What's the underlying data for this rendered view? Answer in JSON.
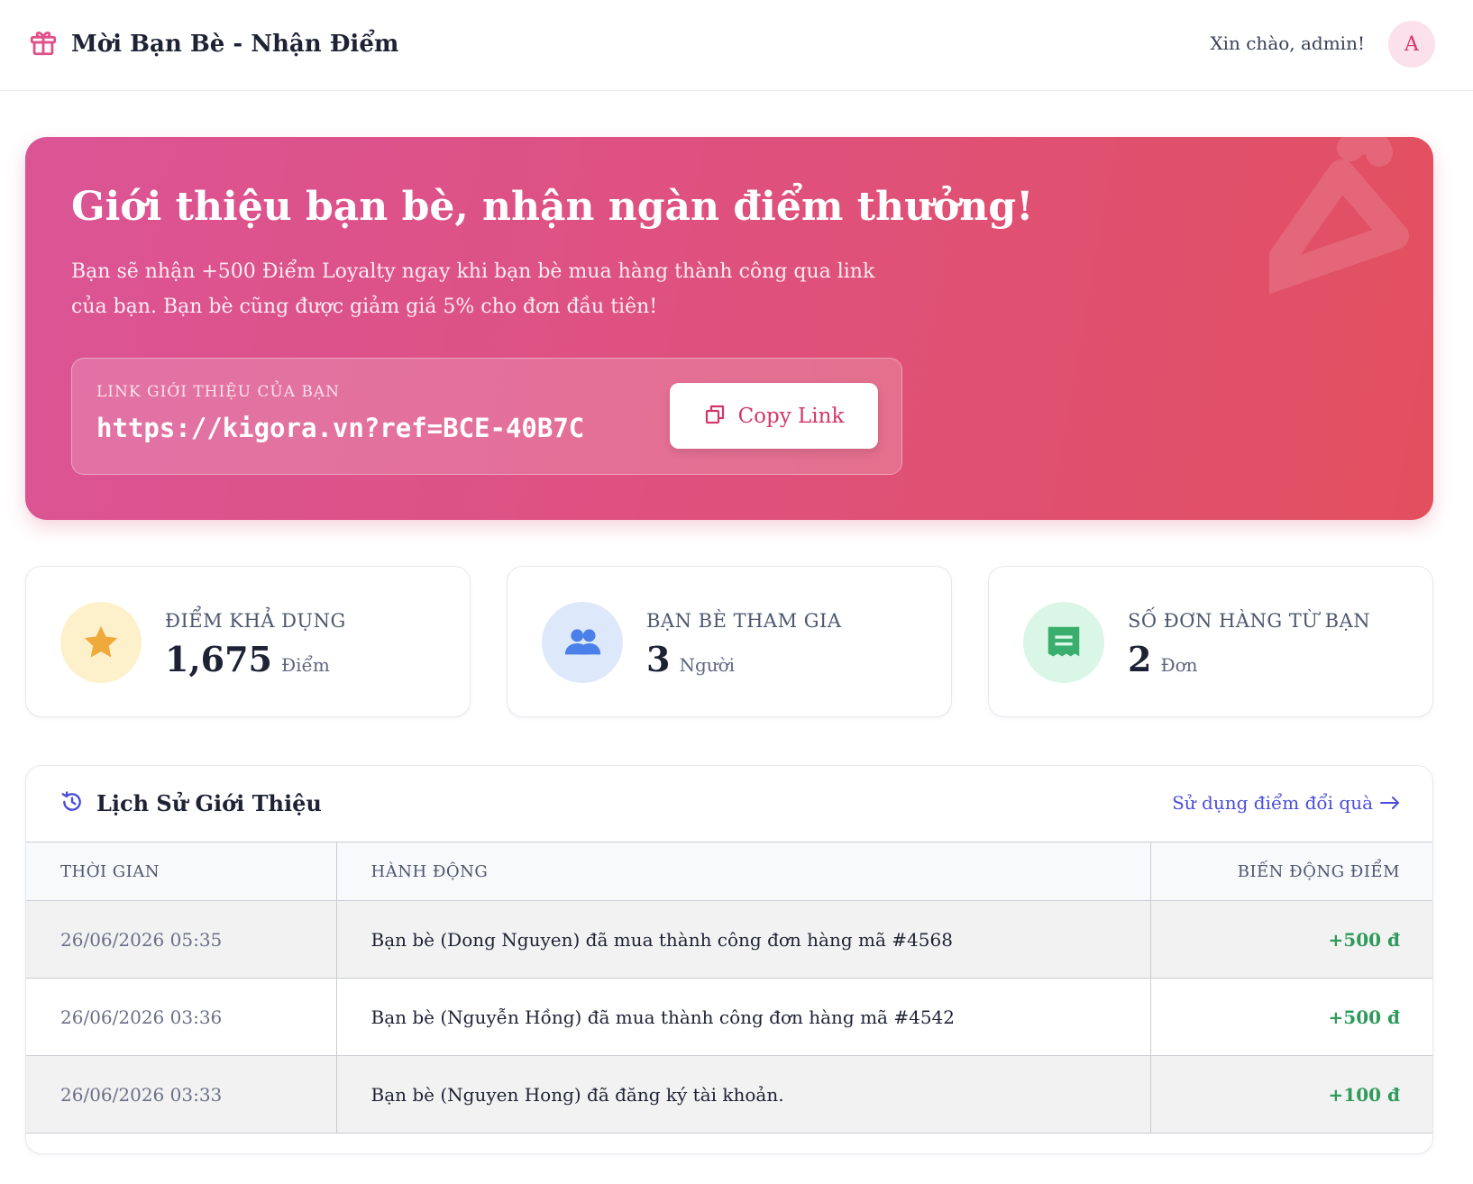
{
  "header": {
    "title": "Mời Bạn Bè - Nhận Điểm",
    "greeting": "Xin chào, admin!",
    "avatar_initial": "A",
    "brand_color": "#e0508a"
  },
  "hero": {
    "title": "Giới thiệu bạn bè, nhận ngàn điểm thưởng!",
    "description": "Bạn sẽ nhận +500 Điểm Loyalty ngay khi bạn bè mua hàng thành công qua link của bạn. Bạn bè cũng được giảm giá 5% cho đơn đầu tiên!",
    "link_label": "LINK GIỚI THIỆU CỦA BẠN",
    "link_url": "https://kigora.vn?ref=BCE-40B7C",
    "copy_button": "Copy Link",
    "gradient": [
      "#db5495",
      "#e2505f"
    ]
  },
  "stats": [
    {
      "icon": "star-icon",
      "label": "ĐIỂM KHẢ DỤNG",
      "value": "1,675",
      "unit": "Điểm",
      "icon_bg": "#fdf1cc",
      "icon_color": "#f0a93b"
    },
    {
      "icon": "users-icon",
      "label": "BẠN BÈ THAM GIA",
      "value": "3",
      "unit": "Người",
      "icon_bg": "#dde8fb",
      "icon_color": "#4a80e8"
    },
    {
      "icon": "receipt-icon",
      "label": "SỐ ĐƠN HÀNG TỪ BẠN",
      "value": "2",
      "unit": "Đơn",
      "icon_bg": "#daf6e6",
      "icon_color": "#3aae6c"
    }
  ],
  "history": {
    "title": "Lịch Sử Giới Thiệu",
    "redeem_link": "Sử dụng điểm đổi quà",
    "columns": [
      "THỜI GIAN",
      "HÀNH ĐỘNG",
      "BIẾN ĐỘNG ĐIỂM"
    ],
    "rows": [
      {
        "time": "26/06/2026 05:35",
        "action": "Bạn bè (Dong Nguyen) đã mua thành công đơn hàng mã #4568",
        "points": "+500 đ"
      },
      {
        "time": "26/06/2026 03:36",
        "action": "Bạn bè (Nguyễn Hồng) đã mua thành công đơn hàng mã #4542",
        "points": "+500 đ"
      },
      {
        "time": "26/06/2026 03:33",
        "action": "Bạn bè (Nguyen Hong) đã đăng ký tài khoản.",
        "points": "+100 đ"
      }
    ],
    "points_color": "#2f9a5b",
    "link_color": "#4a4fd8"
  }
}
